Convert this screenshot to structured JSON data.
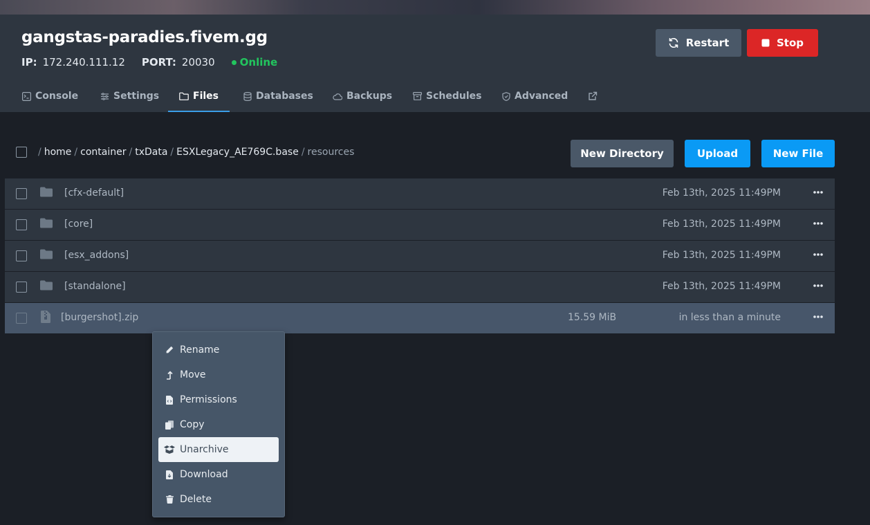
{
  "server": {
    "name": "gangstas-paradies.fivem.gg",
    "ip_label": "IP:",
    "ip": "172.240.111.12",
    "port_label": "PORT:",
    "port": "20030",
    "status": "Online",
    "status_color": "#22c55e"
  },
  "actions": {
    "restart": "Restart",
    "stop": "Stop"
  },
  "tabs": [
    {
      "label": "Console",
      "icon": "terminal-icon"
    },
    {
      "label": "Settings",
      "icon": "sliders-icon"
    },
    {
      "label": "Files",
      "icon": "folder-icon",
      "active": true
    },
    {
      "label": "Databases",
      "icon": "database-icon"
    },
    {
      "label": "Backups",
      "icon": "cloud-icon"
    },
    {
      "label": "Schedules",
      "icon": "archive-icon"
    },
    {
      "label": "Advanced",
      "icon": "shield-icon"
    },
    {
      "label": "",
      "icon": "external-link-icon"
    }
  ],
  "breadcrumb": {
    "root": "/",
    "segments": [
      "home",
      "container",
      "txData",
      "ESXLegacy_AE769C.base",
      "resources"
    ],
    "separator": "/"
  },
  "toolbar": {
    "new_directory": "New Directory",
    "upload": "Upload",
    "new_file": "New File"
  },
  "files": [
    {
      "name": "[cfx-default]",
      "type": "folder",
      "size": "",
      "modified": "Feb 13th, 2025 11:49PM"
    },
    {
      "name": "[core]",
      "type": "folder",
      "size": "",
      "modified": "Feb 13th, 2025 11:49PM"
    },
    {
      "name": "[esx_addons]",
      "type": "folder",
      "size": "",
      "modified": "Feb 13th, 2025 11:49PM"
    },
    {
      "name": "[standalone]",
      "type": "folder",
      "size": "",
      "modified": "Feb 13th, 2025 11:49PM"
    },
    {
      "name": "[burgershot].zip",
      "type": "archive",
      "size": "15.59 MiB",
      "modified": "in less than a minute",
      "selected": true
    }
  ],
  "context_menu": [
    {
      "label": "Rename",
      "icon": "pencil-icon"
    },
    {
      "label": "Move",
      "icon": "level-up-icon"
    },
    {
      "label": "Permissions",
      "icon": "file-code-icon"
    },
    {
      "label": "Copy",
      "icon": "copy-icon"
    },
    {
      "label": "Unarchive",
      "icon": "box-open-icon",
      "highlighted": true
    },
    {
      "label": "Download",
      "icon": "file-download-icon"
    },
    {
      "label": "Delete",
      "icon": "trash-icon"
    }
  ],
  "colors": {
    "accent": "#0a9af5",
    "danger": "#dc2626",
    "tab_underline": "#3b9ee8"
  }
}
